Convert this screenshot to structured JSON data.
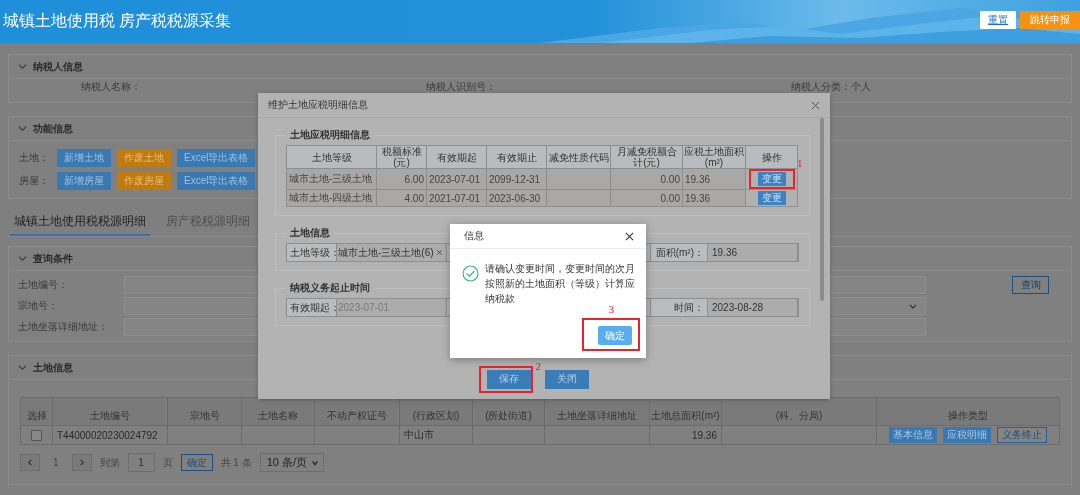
{
  "header": {
    "title": "城镇土地使用税 房产税税源采集",
    "buttons": [
      {
        "label": "重置",
        "kind": "secondary"
      },
      {
        "label": "跳转申报",
        "kind": "primary"
      }
    ]
  },
  "taxpayer_panel": {
    "title": "纳税人信息",
    "expanded": true,
    "fields": [
      {
        "label": "纳税人名称："
      },
      {
        "label": "纳税人识别号："
      },
      {
        "label": "纳税人分类：",
        "value": "个人"
      }
    ]
  },
  "function_panel": {
    "title": "功能信息",
    "expanded": true,
    "rows": [
      {
        "label": "土地：",
        "buttons": [
          {
            "label": "新增土地",
            "kind": "primary"
          },
          {
            "label": "作废土地",
            "kind": "warning"
          },
          {
            "label": "Excel导出表格",
            "kind": "primary"
          }
        ]
      },
      {
        "label": "房屋：",
        "buttons": [
          {
            "label": "新增房屋",
            "kind": "primary"
          },
          {
            "label": "作废房屋",
            "kind": "warning"
          },
          {
            "label": "Excel导出表格",
            "kind": "primary"
          }
        ]
      }
    ]
  },
  "tabs": [
    {
      "label": "城镇土地使用税税源明细",
      "selected": true
    },
    {
      "label": "房产税税源明细",
      "selected": false
    }
  ],
  "query_panel": {
    "title": "查询条件",
    "expanded": true,
    "fields": [
      {
        "label": "土地编号：",
        "kind": "input"
      },
      {
        "label": "宗地号：",
        "kind": "select"
      },
      {
        "label": "土地坐落详细地址：",
        "kind": "input"
      }
    ],
    "search_button": "查询"
  },
  "land_panel": {
    "title": "土地信息",
    "expanded": true,
    "table": {
      "columns": [
        {
          "label": "选择",
          "kind": "checkbox",
          "cells": [
            {
              "checked": false
            }
          ]
        },
        {
          "label": "土地编号",
          "kind": "text",
          "cells": [
            "T44000020230024792"
          ]
        },
        {
          "label": "宗地号"
        },
        {
          "label": "土地名称"
        },
        {
          "label": "不动产权证号"
        },
        {
          "label": "(行政区划)",
          "kind": "text",
          "cells": [
            "中山市"
          ]
        },
        {
          "label": "(所处街道)"
        },
        {
          "label": "土地坐落详细地址"
        },
        {
          "label": "土地总面积(m²)",
          "kind": "number",
          "cells": [
            "19.36"
          ]
        },
        {
          "label": "(科、分局)"
        },
        {
          "label": "操作类型",
          "kind": "actions",
          "cells": [
            [
              {
                "label": "基本信息",
                "kind": "primary"
              },
              {
                "label": "应税明细",
                "kind": "primary"
              },
              {
                "label": "义务终止",
                "kind": "outline"
              }
            ]
          ]
        }
      ]
    },
    "pagination": {
      "current_page": "1",
      "goto_label": "到第",
      "goto_value": "1",
      "page_unit": "页",
      "confirm": "确定",
      "total": "共 1 条",
      "page_size": "10 条/页"
    }
  },
  "edit_dialog": {
    "title": "维护土地应税明细信息",
    "detail_section": {
      "title": "土地应税明细信息",
      "columns": [
        {
          "label": "土地等级",
          "kind": "text",
          "cells": [
            "城市土地-三级土地",
            "城市土地-四级土地"
          ]
        },
        {
          "label": "税额标准(元)",
          "kind": "number",
          "cells": [
            "6.00",
            "4.00"
          ]
        },
        {
          "label": "有效期起",
          "kind": "text",
          "cells": [
            "2023-07-01",
            "2021-07-01"
          ]
        },
        {
          "label": "有效期止",
          "kind": "text",
          "cells": [
            "2099-12-31",
            "2023-06-30"
          ]
        },
        {
          "label": "减免性质代码"
        },
        {
          "label": "月减免税额合计(元)",
          "kind": "number",
          "cells": [
            "0.00",
            "0.00"
          ]
        },
        {
          "label": "应税土地面积(m²)",
          "kind": "text",
          "cells": [
            "19.36",
            "19.36"
          ]
        },
        {
          "label": "操作",
          "kind": "button",
          "cells": [
            {
              "label": "变更",
              "annotation": "1"
            },
            {
              "label": "变更"
            }
          ]
        }
      ]
    },
    "land_section": {
      "title": "土地信息",
      "fields": [
        {
          "label": "土地等级：",
          "value": "城市土地-三级土地(6)",
          "clearable": true,
          "disabled": false
        },
        {
          "label": "面积(m²)：",
          "value": "19.36",
          "clearable": false,
          "disabled": false
        }
      ]
    },
    "period_section": {
      "title": "纳税义务起止时间",
      "fields": [
        {
          "label": "有效期起：",
          "value": "2023-07-01",
          "clearable": false,
          "disabled": true
        },
        {
          "label": "时间：",
          "value": "2023-08-28",
          "clearable": false,
          "disabled": false
        }
      ]
    },
    "buttons": [
      {
        "label": "保存",
        "annotation": "2"
      },
      {
        "label": "关闭"
      }
    ]
  },
  "info_dialog": {
    "title": "信息",
    "message": "请确认变更时间，变更时间的次月按照新的土地面积（等级）计算应纳税款",
    "buttons": [
      {
        "label": "确定",
        "annotation": "3"
      }
    ]
  }
}
